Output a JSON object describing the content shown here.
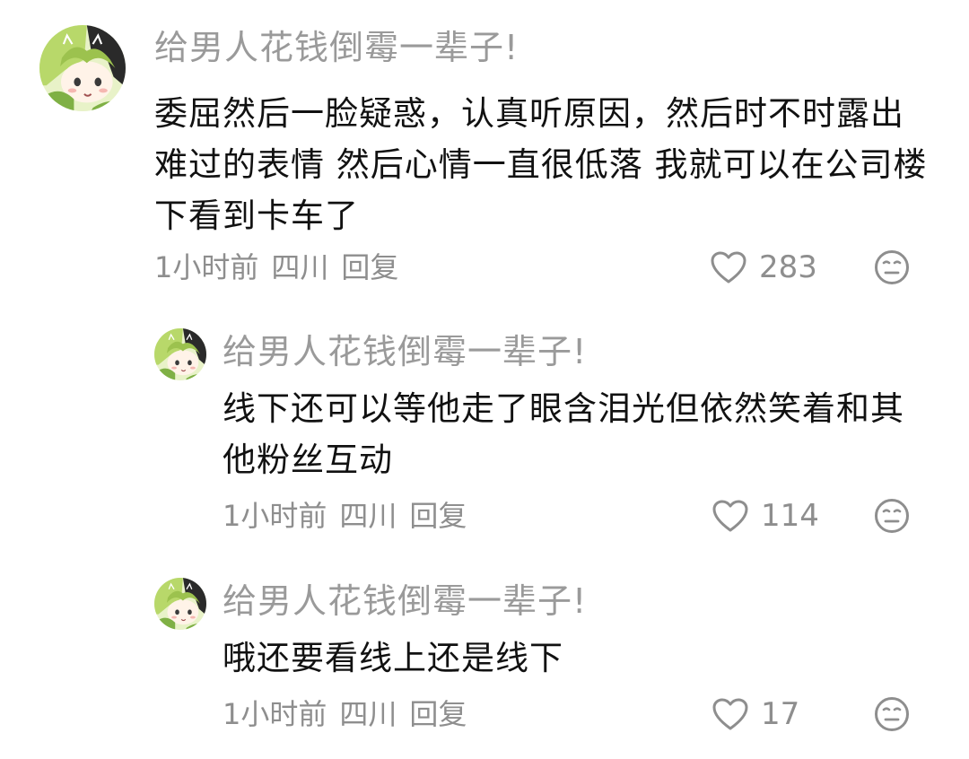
{
  "comments": [
    {
      "username": "给男人花钱倒霉一辈子!",
      "text": "委屈然后一脸疑惑，认真听原因，然后时不时露出难过的表情 然后心情一直很低落 我就可以在公司楼下看到卡车了",
      "time": "1小时前",
      "location": "四川",
      "reply_label": "回复",
      "likes": "283",
      "like_icon": "heart-outline-icon",
      "dislike_icon": "neutral-face-icon"
    },
    {
      "username": "给男人花钱倒霉一辈子!",
      "text": "线下还可以等他走了眼含泪光但依然笑着和其他粉丝互动",
      "time": "1小时前",
      "location": "四川",
      "reply_label": "回复",
      "likes": "114",
      "like_icon": "heart-outline-icon",
      "dislike_icon": "neutral-face-icon"
    },
    {
      "username": "给男人花钱倒霉一辈子!",
      "text": "哦还要看线上还是线下",
      "time": "1小时前",
      "location": "四川",
      "reply_label": "回复",
      "likes": "17",
      "like_icon": "heart-outline-icon",
      "dislike_icon": "neutral-face-icon"
    }
  ],
  "colors": {
    "text_primary": "#111111",
    "text_secondary": "#8e8e8e",
    "username": "#9a9a9a",
    "avatar_green": "#b8d86a",
    "avatar_dark": "#2a2a2a"
  }
}
